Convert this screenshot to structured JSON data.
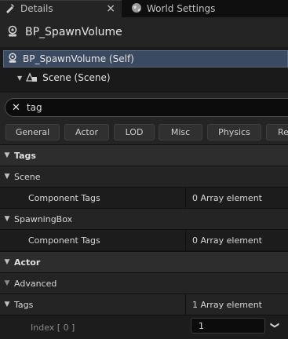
{
  "tabs": {
    "details": "Details",
    "world_settings": "World Settings",
    "close_glyph": "×"
  },
  "actor": {
    "name": "BP_SpawnVolume"
  },
  "tree": {
    "self_label": "BP_SpawnVolume (Self)",
    "scene_label": "Scene (Scene)"
  },
  "search": {
    "value": "tag",
    "clear_glyph": "✕"
  },
  "filters": [
    "General",
    "Actor",
    "LOD",
    "Misc",
    "Physics",
    "Re"
  ],
  "sections": {
    "tags_category": "Tags",
    "scene_section": "Scene",
    "component_tags_1": "Component Tags",
    "component_tags_1_value": "0 Array element",
    "spawning_box_section": "SpawningBox",
    "component_tags_2": "Component Tags",
    "component_tags_2_value": "0 Array element",
    "actor_category": "Actor",
    "advanced_section": "Advanced",
    "tags_row": "Tags",
    "tags_row_value": "1 Array element",
    "index_label": "Index [ 0 ]",
    "index_value": "1"
  },
  "colors": {
    "selected_row": "#3a4a60",
    "panel_bg": "#242424",
    "category_bg": "#2d2d2d"
  }
}
